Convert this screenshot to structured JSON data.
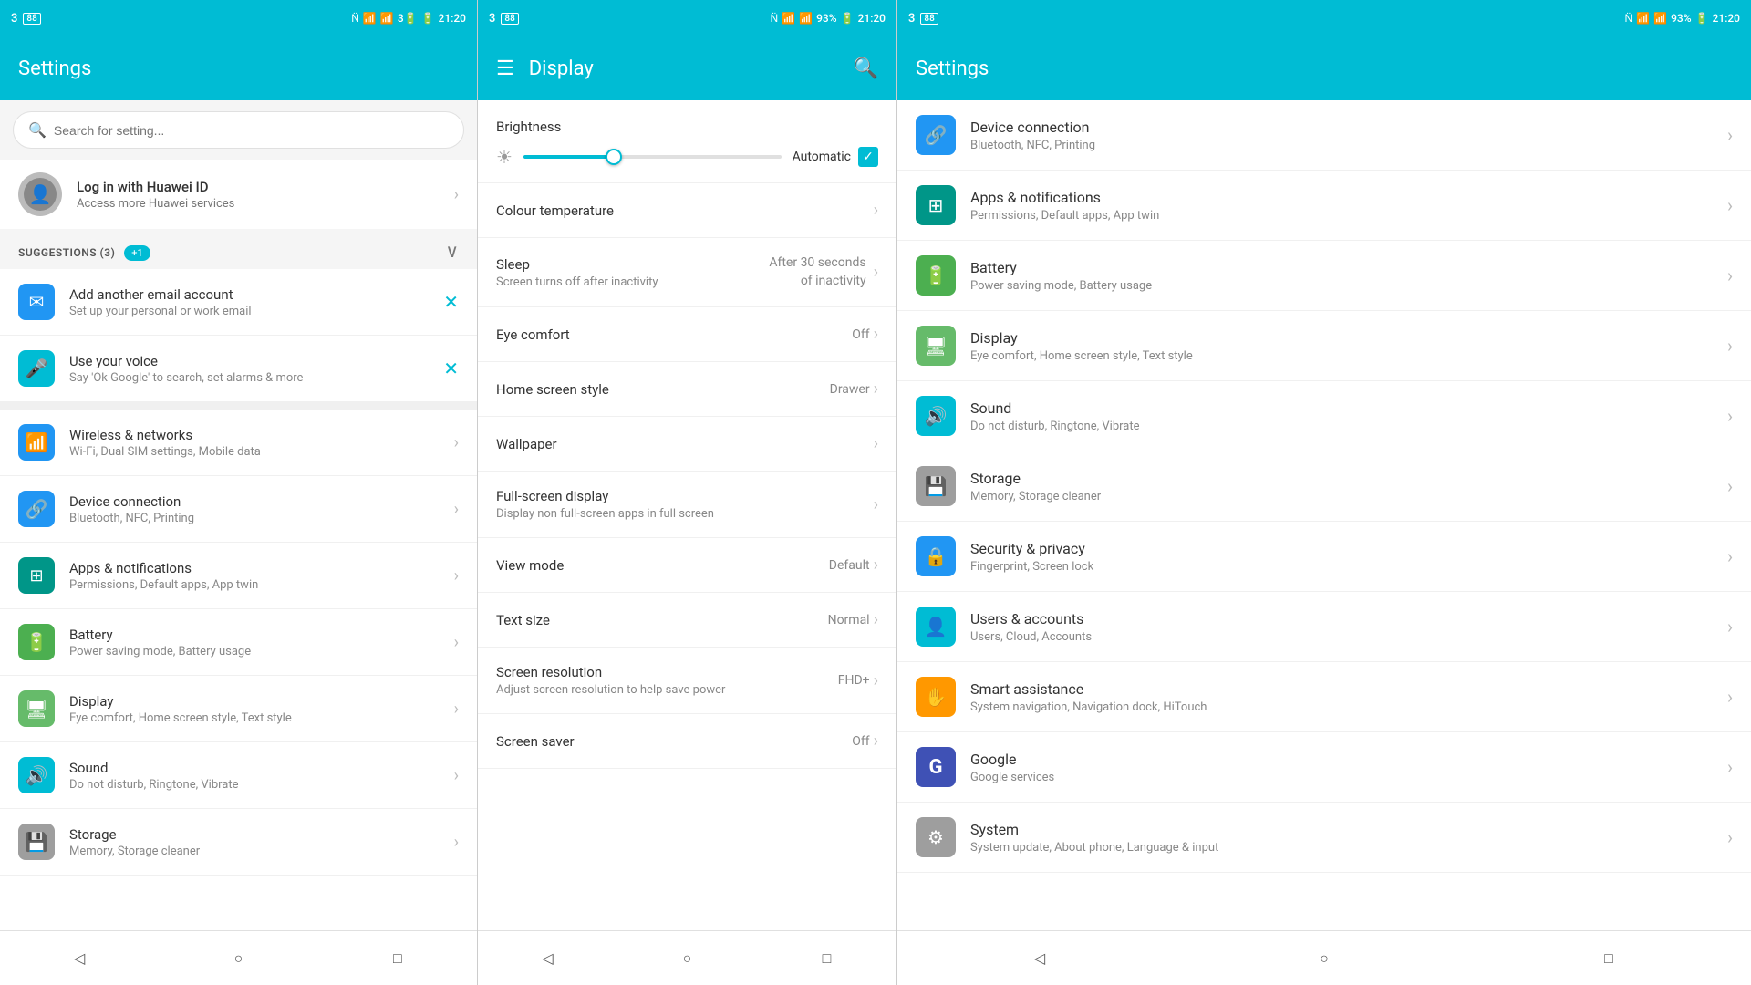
{
  "left_panel": {
    "status_bar": {
      "left": "3🔋",
      "signal": "N̈  ✦  📶 93%  🔋 21:20"
    },
    "app_bar": {
      "title": "Settings"
    },
    "search": {
      "placeholder": "Search for setting..."
    },
    "profile": {
      "name": "Log in with Huawei ID",
      "sub": "Access more Huawei services"
    },
    "suggestions_header": {
      "label": "SUGGESTIONS (3)",
      "badge": "+1"
    },
    "suggestions": [
      {
        "icon": "✉",
        "icon_bg": "bg-blue",
        "title": "Add another email account",
        "sub": "Set up your personal or work email",
        "action": "close"
      },
      {
        "icon": "🎤",
        "icon_bg": "bg-cyan",
        "title": "Use your voice",
        "sub": "Say 'Ok Google' to search, set alarms & more",
        "action": "close"
      }
    ],
    "settings": [
      {
        "icon": "📶",
        "icon_bg": "bg-blue",
        "title": "Wireless & networks",
        "sub": "Wi-Fi, Dual SIM settings, Mobile data"
      },
      {
        "icon": "🔗",
        "icon_bg": "bg-blue",
        "title": "Device connection",
        "sub": "Bluetooth, NFC, Printing"
      },
      {
        "icon": "⊞",
        "icon_bg": "bg-teal",
        "title": "Apps & notifications",
        "sub": "Permissions, Default apps, App twin"
      },
      {
        "icon": "🔋",
        "icon_bg": "bg-green",
        "title": "Battery",
        "sub": "Power saving mode, Battery usage"
      },
      {
        "icon": "🖥",
        "icon_bg": "bg-green2",
        "title": "Display",
        "sub": "Eye comfort, Home screen style, Text style"
      },
      {
        "icon": "🔊",
        "icon_bg": "bg-cyan",
        "title": "Sound",
        "sub": "Do not disturb, Ringtone, Vibrate"
      },
      {
        "icon": "💾",
        "icon_bg": "bg-grey",
        "title": "Storage",
        "sub": "Memory, Storage cleaner"
      }
    ],
    "nav": {
      "back": "◁",
      "home": "○",
      "recent": "□"
    }
  },
  "middle_panel": {
    "status_bar": {
      "text": "3🔋  N̈  ✦  📶 93%  🔋 21:20"
    },
    "app_bar": {
      "title": "Display",
      "menu": "☰",
      "search": "🔍"
    },
    "brightness": {
      "label": "Brightness",
      "auto_label": "Automatic",
      "slider_percent": 35
    },
    "settings": [
      {
        "title": "Colour temperature",
        "sub": "",
        "value": "",
        "has_chevron": true
      },
      {
        "title": "Sleep",
        "sub": "Screen turns off after inactivity",
        "value": "After 30 seconds\nof inactivity",
        "has_chevron": true,
        "is_sleep": true
      },
      {
        "title": "Eye comfort",
        "sub": "",
        "value": "Off",
        "has_chevron": true
      },
      {
        "title": "Home screen style",
        "sub": "",
        "value": "Drawer",
        "has_chevron": true
      },
      {
        "title": "Wallpaper",
        "sub": "",
        "value": "",
        "has_chevron": true
      },
      {
        "title": "Full-screen display",
        "sub": "Display non full-screen apps in full screen",
        "value": "",
        "has_chevron": true
      },
      {
        "title": "View mode",
        "sub": "",
        "value": "Default",
        "has_chevron": true
      },
      {
        "title": "Text size",
        "sub": "",
        "value": "Normal",
        "has_chevron": true
      },
      {
        "title": "Screen resolution",
        "sub": "Adjust screen resolution to help save power",
        "value": "FHD+",
        "has_chevron": true
      },
      {
        "title": "Screen saver",
        "sub": "",
        "value": "Off",
        "has_chevron": true
      }
    ],
    "nav": {
      "back": "◁",
      "home": "○",
      "recent": "□"
    }
  },
  "right_panel": {
    "status_bar": {
      "text": "3🔋  N̈  ✦  📶 93%  🔋 21:20"
    },
    "app_bar": {
      "title": "Settings"
    },
    "settings": [
      {
        "icon": "🔗",
        "icon_bg": "bg-blue",
        "title": "Device connection",
        "sub": "Bluetooth, NFC, Printing"
      },
      {
        "icon": "⊞",
        "icon_bg": "bg-teal",
        "title": "Apps & notifications",
        "sub": "Permissions, Default apps, App twin"
      },
      {
        "icon": "🔋",
        "icon_bg": "bg-green",
        "title": "Battery",
        "sub": "Power saving mode, Battery usage"
      },
      {
        "icon": "🖥",
        "icon_bg": "bg-green2",
        "title": "Display",
        "sub": "Eye comfort, Home screen style, Text style"
      },
      {
        "icon": "🔊",
        "icon_bg": "bg-cyan",
        "title": "Sound",
        "sub": "Do not disturb, Ringtone, Vibrate"
      },
      {
        "icon": "💾",
        "icon_bg": "bg-grey",
        "title": "Storage",
        "sub": "Memory, Storage cleaner"
      },
      {
        "icon": "🔒",
        "icon_bg": "bg-blue",
        "title": "Security & privacy",
        "sub": "Fingerprint, Screen lock"
      },
      {
        "icon": "👤",
        "icon_bg": "bg-cyan",
        "title": "Users & accounts",
        "sub": "Users, Cloud, Accounts"
      },
      {
        "icon": "✋",
        "icon_bg": "bg-orange",
        "title": "Smart assistance",
        "sub": "System navigation, Navigation dock, HiTouch"
      },
      {
        "icon": "G",
        "icon_bg": "bg-indigo",
        "title": "Google",
        "sub": "Google services"
      },
      {
        "icon": "⚙",
        "icon_bg": "bg-grey",
        "title": "System",
        "sub": "System update, About phone, Language & input"
      }
    ],
    "nav": {
      "back": "◁",
      "home": "○",
      "recent": "□"
    }
  }
}
